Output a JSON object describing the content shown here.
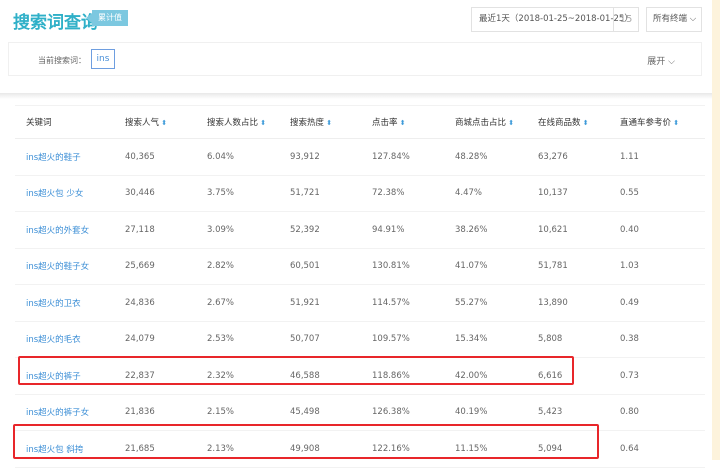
{
  "header": {
    "title": "搜索词查询",
    "badge": "累计值",
    "date_range": "最近1天（2018-01-25~2018-01-25）",
    "calendar_icon": "15",
    "terminal": "所有终端"
  },
  "search": {
    "label": "当前搜索词：",
    "value": "ins",
    "expand": "展开"
  },
  "table": {
    "columns": [
      "关键词",
      "搜索人气",
      "搜索人数占比",
      "搜索热度",
      "点击率",
      "商城点击占比",
      "在线商品数",
      "直通车参考价"
    ],
    "rows": [
      [
        "ins超火的鞋子",
        "40,365",
        "6.04%",
        "93,912",
        "127.84%",
        "48.28%",
        "63,276",
        "1.11"
      ],
      [
        "ins超火包 少女",
        "30,446",
        "3.75%",
        "51,721",
        "72.38%",
        "4.47%",
        "10,137",
        "0.55"
      ],
      [
        "ins超火的外套女",
        "27,118",
        "3.09%",
        "52,392",
        "94.91%",
        "38.26%",
        "10,621",
        "0.40"
      ],
      [
        "ins超火的鞋子女",
        "25,669",
        "2.82%",
        "60,501",
        "130.81%",
        "41.07%",
        "51,781",
        "1.03"
      ],
      [
        "ins超火的卫衣",
        "24,836",
        "2.67%",
        "51,921",
        "114.57%",
        "55.27%",
        "13,890",
        "0.49"
      ],
      [
        "ins超火的毛衣",
        "24,079",
        "2.53%",
        "50,707",
        "109.57%",
        "15.34%",
        "5,808",
        "0.38"
      ],
      [
        "ins超火的裤子",
        "22,837",
        "2.32%",
        "46,588",
        "118.86%",
        "42.00%",
        "6,616",
        "0.73"
      ],
      [
        "ins超火的裤子女",
        "21,836",
        "2.15%",
        "45,498",
        "126.38%",
        "40.19%",
        "5,423",
        "0.80"
      ],
      [
        "ins超火包 斜挎",
        "21,685",
        "2.13%",
        "49,908",
        "122.16%",
        "11.15%",
        "5,094",
        "0.64"
      ]
    ]
  },
  "colors": {
    "accent": "#2fb0c8",
    "link": "#3d8fd6",
    "highlight": "#e8262a"
  }
}
